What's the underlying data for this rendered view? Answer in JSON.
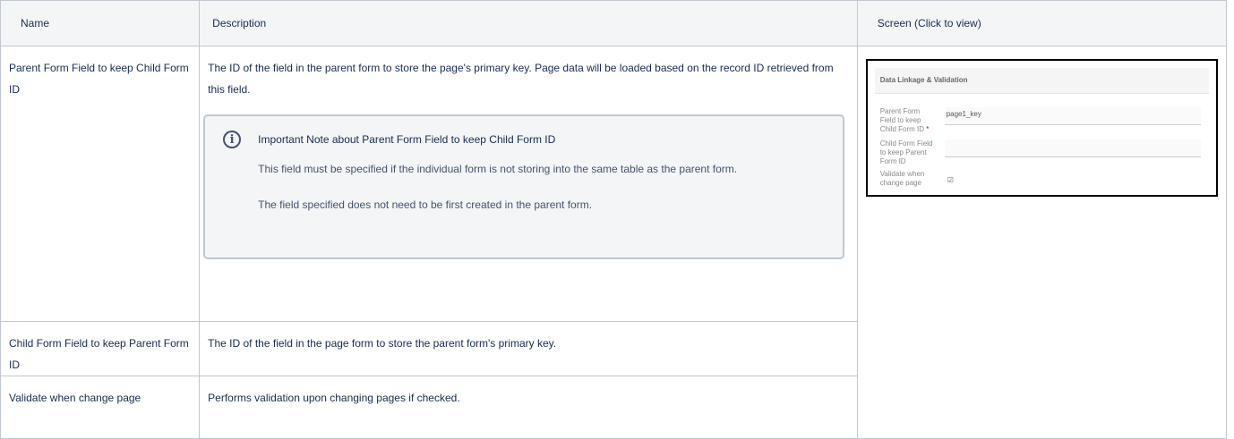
{
  "table": {
    "headers": {
      "name": "Name",
      "description": "Description",
      "screen": "Screen (Click to view)"
    },
    "rows": [
      {
        "name": "Parent Form Field to keep Child Form ID",
        "description": "The ID of the field in the parent form to store the page's primary key. Page data will be loaded based on the record ID retrieved from this field.",
        "note": {
          "icon": "info-icon",
          "title": "Important Note about Parent Form Field to keep Child Form ID",
          "paragraphs": [
            "This field must be specified if the individual form is not storing into the same table as the parent form.",
            "The field specified does not need to be first created in the parent form."
          ]
        }
      },
      {
        "name": "Child Form Field to keep Parent Form ID",
        "description": "The ID of the field in the page form to store the parent form's primary key."
      },
      {
        "name": "Validate when change page",
        "description": "Performs validation upon changing pages if checked."
      }
    ]
  },
  "screenshot": {
    "section_title": "Data Linkage & Validation",
    "fields": [
      {
        "label": "Parent Form Field to keep Child Form ID",
        "required_mark": "*",
        "value": "page1_key"
      },
      {
        "label": "Child Form Field to keep Parent Form ID",
        "value": ""
      },
      {
        "label": "Validate when change page",
        "checked": true
      }
    ]
  },
  "colors": {
    "border": "#c1c7d0",
    "header_bg": "#f4f5f7",
    "note_bg": "#f4f5f7",
    "text": "#172b4d"
  }
}
